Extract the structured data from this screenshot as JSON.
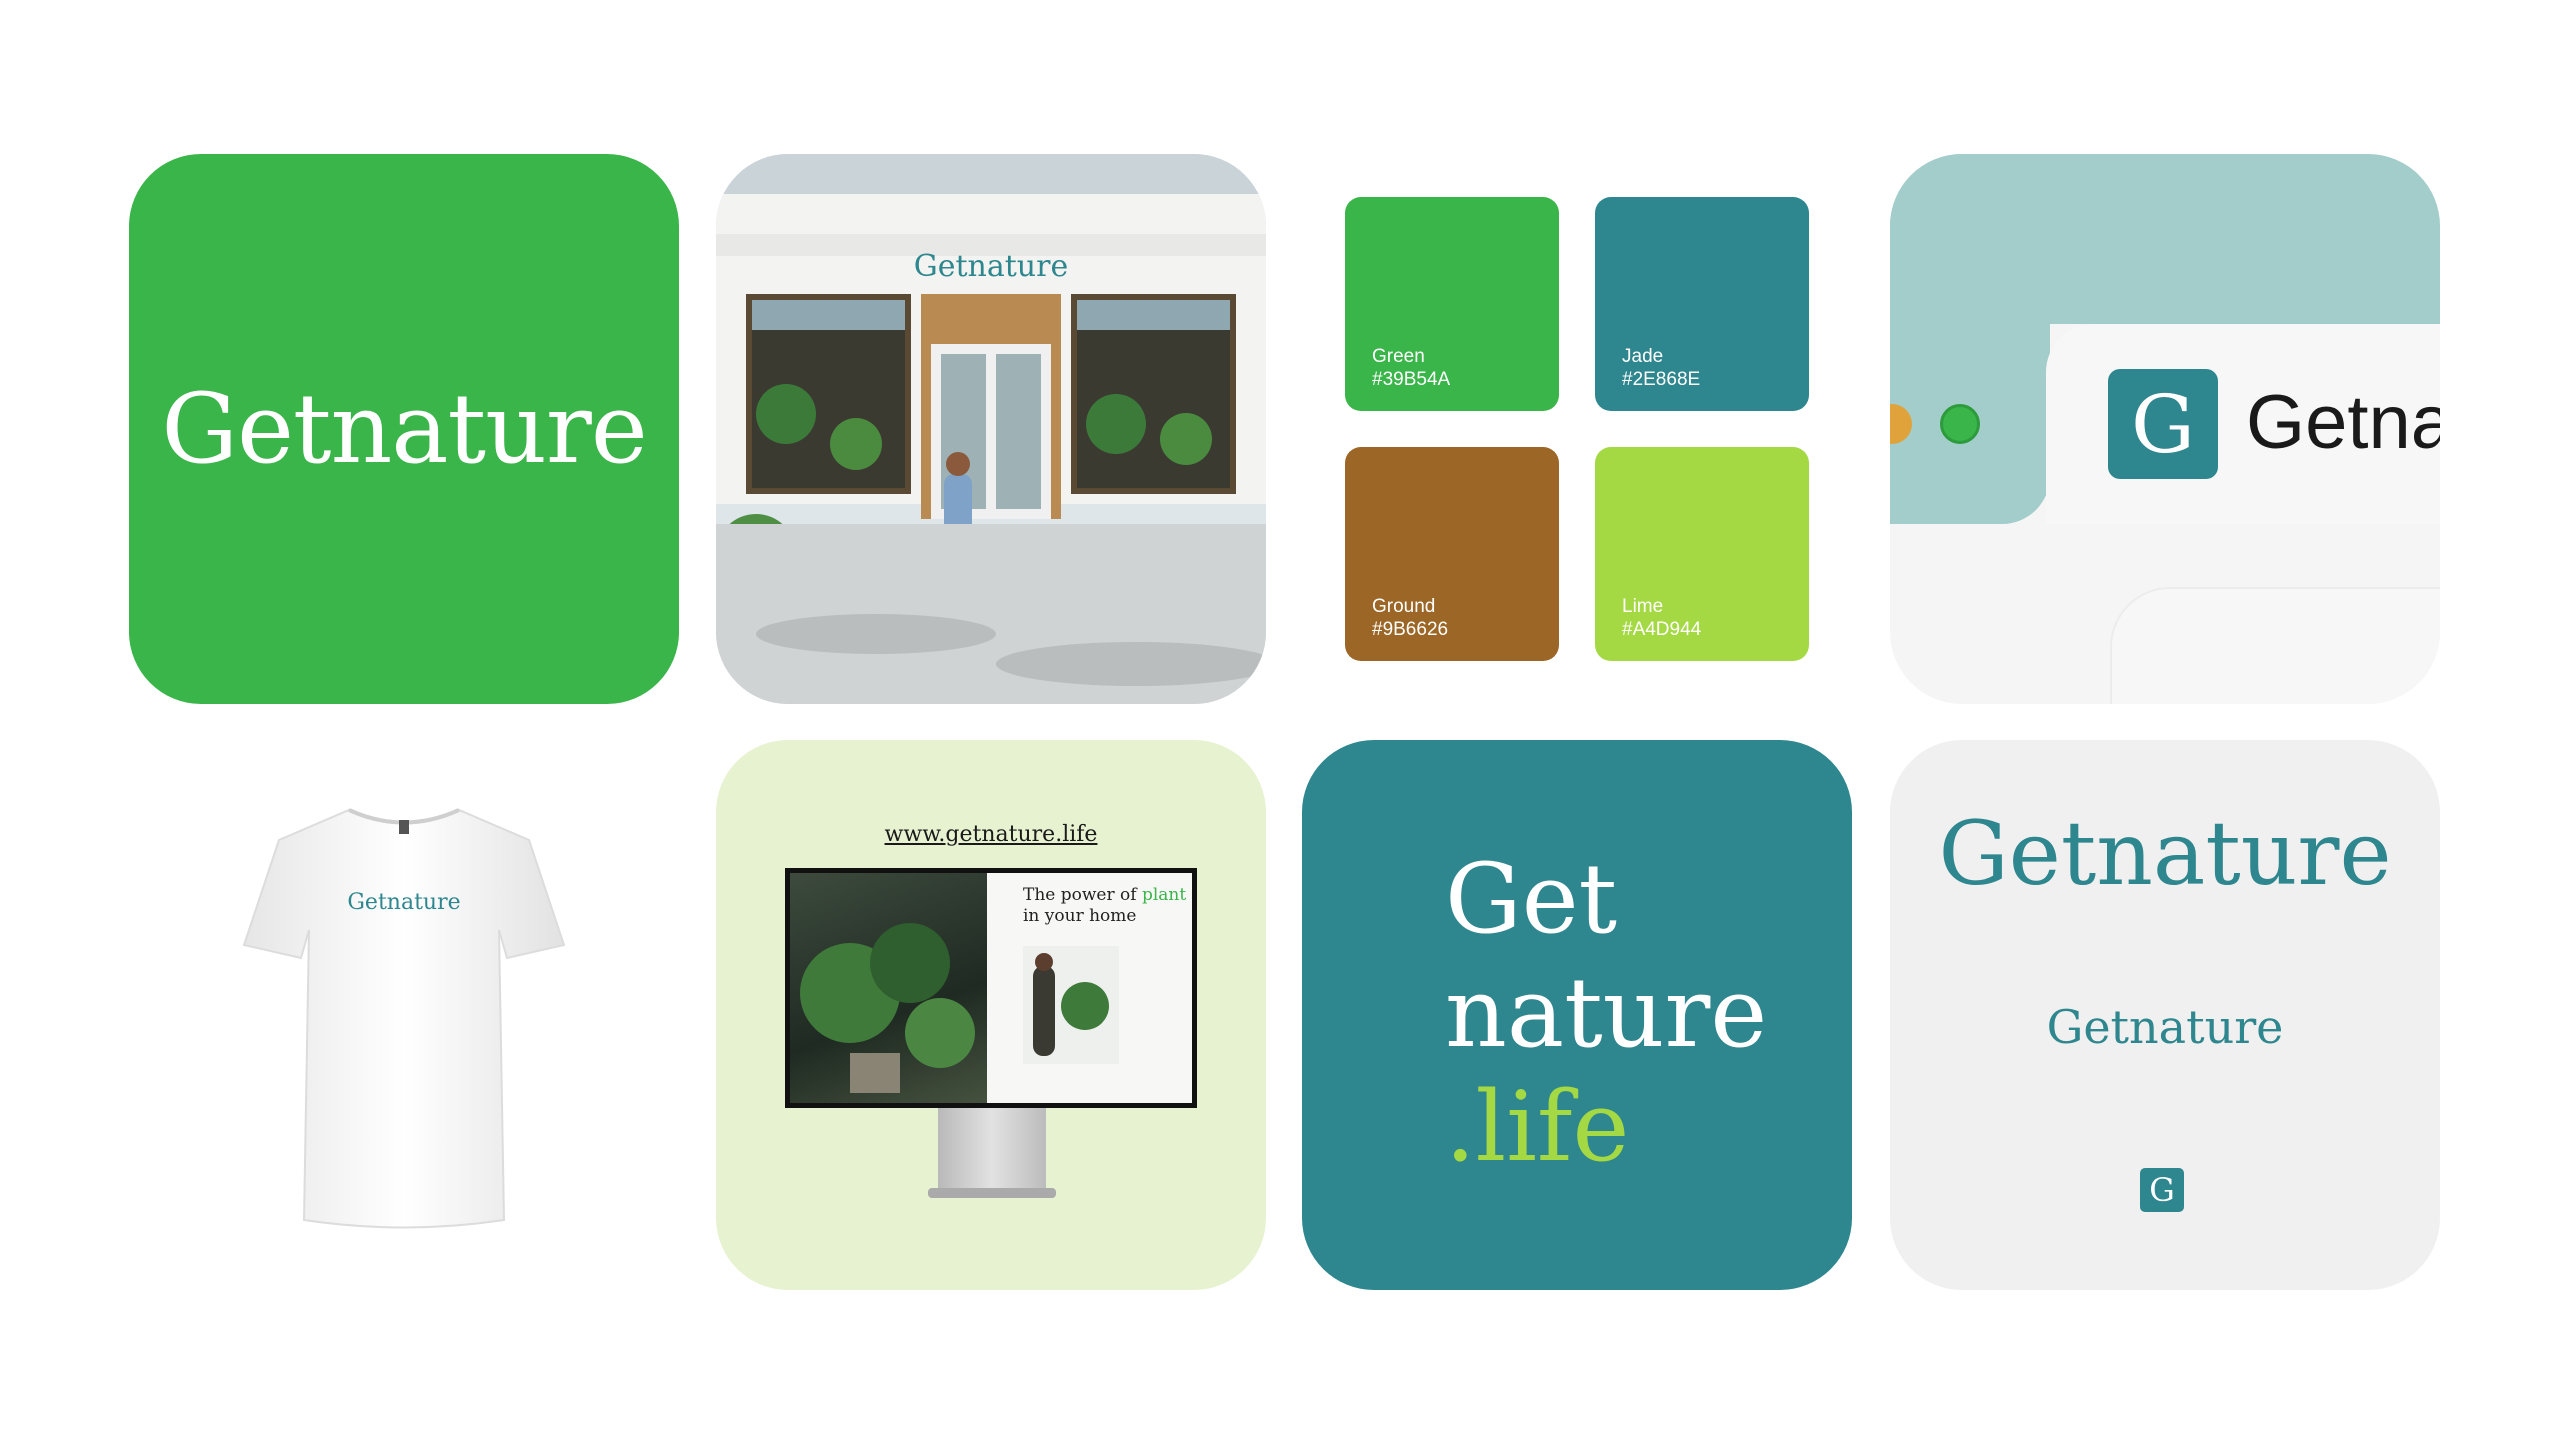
{
  "brand": {
    "logo_text": "Getnature",
    "monogram": "G"
  },
  "storefront": {
    "sign": "Getnature"
  },
  "palette": [
    {
      "name": "Green",
      "hex": "#39B54A"
    },
    {
      "name": "Jade",
      "hex": "#2E868E"
    },
    {
      "name": "Ground",
      "hex": "#9B6626"
    },
    {
      "name": "Lime",
      "hex": "#A4D944"
    }
  ],
  "app_mockup": {
    "badge": "G",
    "wordmark": "Getna",
    "dot_colors": [
      "#E0A23A",
      "#39B54A"
    ]
  },
  "tshirt": {
    "print": "Getnature"
  },
  "website": {
    "url": "www.getnature.life",
    "headline_before": "The power of ",
    "headline_accent": "plant",
    "headline_after": "in your home"
  },
  "slogan": {
    "line1": "Get",
    "line2": "nature",
    "line3": ".life"
  },
  "logo_variants": {
    "large": "Getnature",
    "medium": "Getnature",
    "icon": "G"
  }
}
